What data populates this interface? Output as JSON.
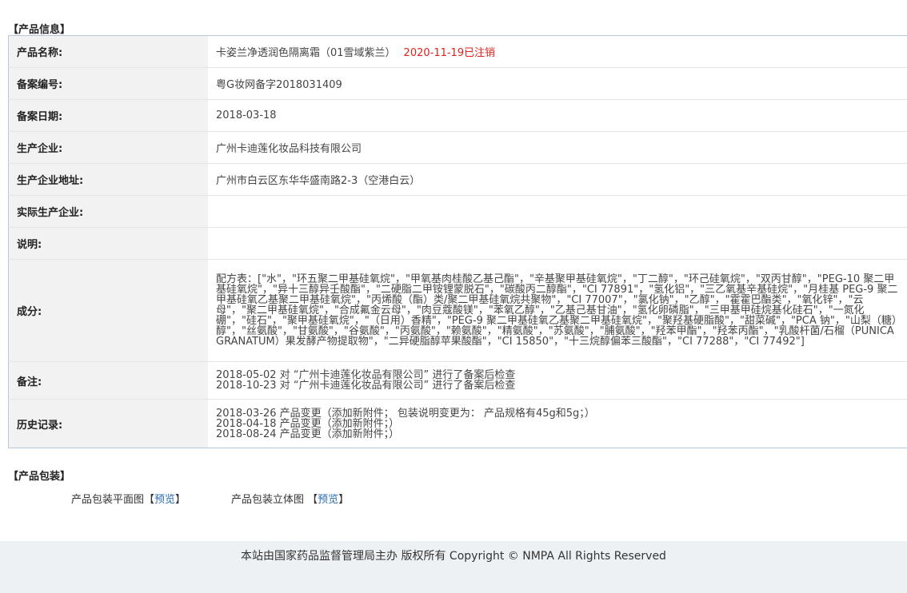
{
  "sections": {
    "info_title": "【产品信息】",
    "package_title": "【产品包装】"
  },
  "product": {
    "name_label": "产品名称:",
    "name_value": "卡姿兰净透润色隔离霜（01雪域紫兰）",
    "cancel_status": "2020-11-19已注销",
    "record_no_label": "备案编号:",
    "record_no_value": "粤G妆网备字2018031409",
    "record_date_label": "备案日期:",
    "record_date_value": "2018-03-18",
    "manufacturer_label": "生产企业:",
    "manufacturer_value": "广州卡迪莲化妆品科技有限公司",
    "address_label": "生产企业地址:",
    "address_value": "广州市白云区东华华盛南路2-3（空港白云）",
    "actual_manufacturer_label": "实际生产企业:",
    "actual_manufacturer_value": "",
    "note_label": "说明:",
    "note_value": "",
    "ingredients_label": "成分:",
    "ingredients_value": "配方表：[\"水\"，\"环五聚二甲基硅氧烷\"，\"甲氧基肉桂酸乙基己酯\"，\"辛基聚甲基硅氧烷\"，\"丁二醇\"，\"环己硅氧烷\"，\"双丙甘醇\"，\"PEG-10 聚二甲基硅氧烷\"，\"异十三醇异壬酸酯\"，\"二硬脂二甲铵锂蒙脱石\"，\"碳酸丙二醇酯\"，\"CI 77891\"，\"氢化铝\"，\"三乙氧基辛基硅烷\"，\"月桂基 PEG-9 聚二甲基硅氧乙基聚二甲基硅氧烷\"，\"丙烯酸（酯）类/聚二甲基硅氧烷共聚物\"，\"CI 77007\"，\"氯化钠\"，\"乙醇\"，\"霍霍巴酯类\"，\"氧化锌\"，\"云母\"，\"聚二甲基硅氧烷\"，\"合成氟金云母\"，\"肉豆蔻酸镁\"，\"苯氧乙醇\"，\"乙基己基甘油\"，\"氢化卵磷脂\"，\"三甲基甲硅烷基化硅石\"，\"一氮化硼\"，\"硅石\"，\"聚甲基硅氧烷\"，\"（日用）香精\"，\"PEG-9 聚二甲基硅氧乙基聚二甲基硅氧烷\"，\"聚羟基硬脂酸\"，\"甜菜碱\"，\"PCA 钠\"，\"山梨（糖）醇\"，\"丝氨酸\"，\"甘氨酸\"，\"谷氨酸\"，\"丙氨酸\"，\"赖氨酸\"，\"精氨酸\"，\"苏氨酸\"，\"脯氨酸\"，\"羟苯甲酯\"，\"羟苯丙酯\"，\"乳酸杆菌/石榴（PUNICA GRANATUM）果发酵产物提取物\"，\"二异硬脂醇苹果酸酯\"，\"CI 15850\"，\"十三烷醇偏苯三酸酯\"，\"CI 77288\"，\"CI 77492\"]",
    "remarks_label": "备注:",
    "remarks_line1": "2018-05-02 对 “广州卡迪莲化妆品有限公司” 进行了备案后检查",
    "remarks_line2": "2018-10-23 对 “广州卡迪莲化妆品有限公司” 进行了备案后检查",
    "history_label": "历史记录:",
    "history_line1": "2018-03-26 产品变更（添加新附件；  包装说明变更为：  产品规格有45g和5g；）",
    "history_line2": "2018-04-18 产品变更（添加新附件；）",
    "history_line3": "2018-08-24 产品变更（添加新附件；）"
  },
  "packaging": {
    "flat_label": "产品包装平面图",
    "flat_bracket_open": "【",
    "flat_link": "预览",
    "flat_bracket_close": "】",
    "solid_label": "产品包装立体图",
    "solid_bracket_open": "【",
    "solid_link": "预览",
    "solid_bracket_close": "】"
  },
  "footer": {
    "text": "本站由国家药品监督管理局主办 版权所有 Copyright © NMPA All Rights Reserved"
  }
}
